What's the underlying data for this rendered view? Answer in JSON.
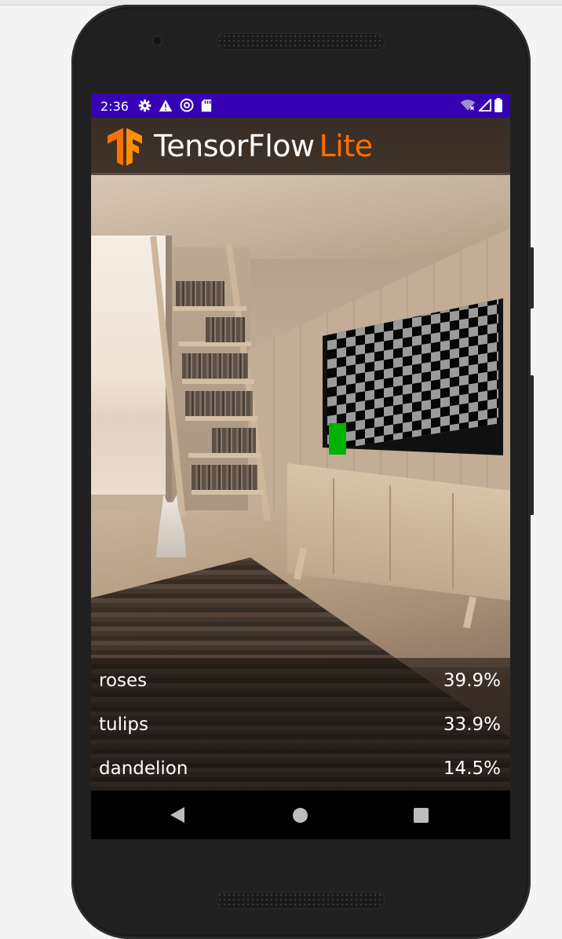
{
  "status_bar": {
    "time": "2:36",
    "left_icons": [
      "settings-icon",
      "warning-icon",
      "at-sign-icon",
      "sd-card-icon"
    ],
    "right_icons": [
      "wifi-icon",
      "cell-signal-icon",
      "battery-icon"
    ],
    "background_color": "#3700b3"
  },
  "app_bar": {
    "logo": "tensorflow-logo-icon",
    "brand_main": "TensorFlow",
    "brand_lite": "Lite",
    "brand_accent_color": "#ff6f00"
  },
  "results": [
    {
      "label": "roses",
      "score": "39.9%"
    },
    {
      "label": "tulips",
      "score": "33.9%"
    },
    {
      "label": "dandelion",
      "score": "14.5%"
    }
  ],
  "nav_bar": {
    "buttons": [
      "back-icon",
      "home-icon",
      "recents-icon"
    ]
  }
}
